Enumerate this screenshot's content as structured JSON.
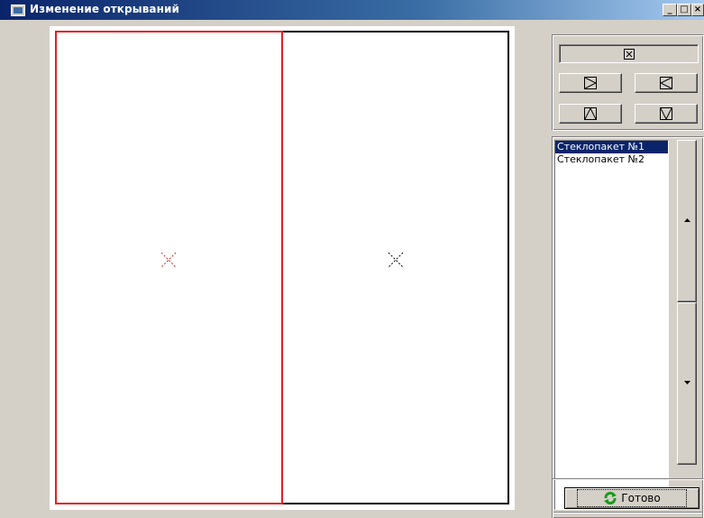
{
  "window": {
    "title": "Изменение открываний",
    "app_icon": "app-window-icon",
    "minimize_label": "_",
    "restore_label": "□",
    "close_label": "×"
  },
  "canvas": {
    "selected_color": "#e02020",
    "frame_color": "#000000",
    "panes": [
      {
        "name": "glass-pane-1",
        "selected": true
      },
      {
        "name": "glass-pane-2",
        "selected": false
      }
    ]
  },
  "open_controls": {
    "none_icon": "close-square-icon",
    "right_icon": "triangle-right-icon",
    "left_icon": "triangle-left-icon",
    "up_icon": "triangle-up-icon",
    "down_icon": "triangle-down-icon"
  },
  "list": {
    "items": [
      "Стеклопакет №1",
      "Стеклопакет №2"
    ],
    "selected_index": 0
  },
  "footer": {
    "done_label": "Готово",
    "done_icon": "refresh-icon",
    "done_icon_color": "#1a9a1a"
  }
}
